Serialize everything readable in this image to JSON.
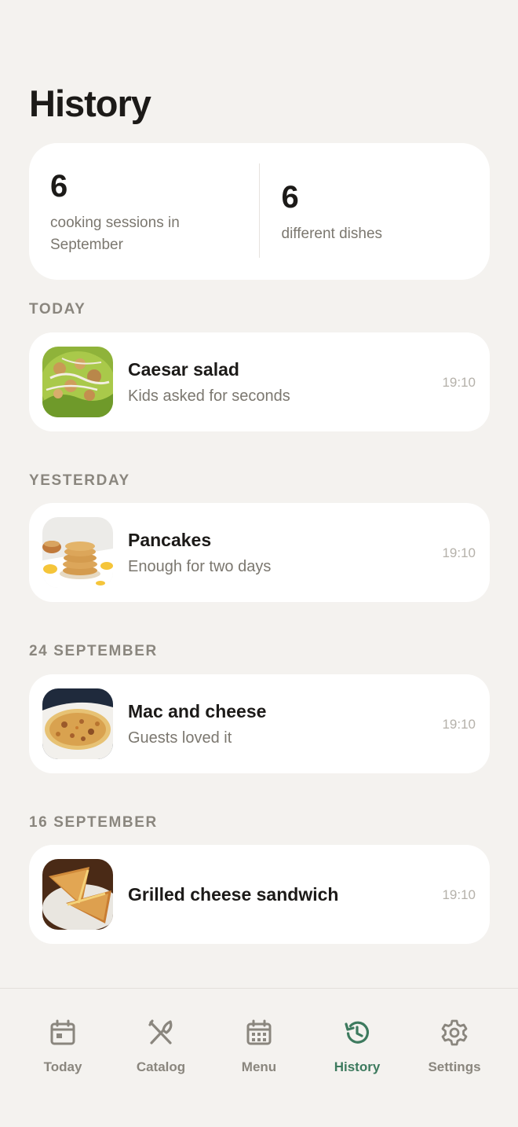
{
  "page": {
    "title": "History"
  },
  "stats": {
    "sessions": {
      "value": "6",
      "label": "cooking sessions in September"
    },
    "dishes": {
      "value": "6",
      "label": "different dishes"
    }
  },
  "sections": [
    {
      "header": "TODAY",
      "entry": {
        "title": "Caesar salad",
        "note": "Kids asked for seconds",
        "time": "19:10",
        "thumb": "caesar-salad-photo"
      }
    },
    {
      "header": "YESTERDAY",
      "entry": {
        "title": "Pancakes",
        "note": "Enough for two days",
        "time": "19:10",
        "thumb": "pancakes-photo"
      }
    },
    {
      "header": "24 SEPTEMBER",
      "entry": {
        "title": "Mac and cheese",
        "note": "Guests loved it",
        "time": "19:10",
        "thumb": "mac-and-cheese-photo"
      }
    },
    {
      "header": "16 SEPTEMBER",
      "entry": {
        "title": "Grilled cheese sandwich",
        "note": "",
        "time": "19:10",
        "thumb": "grilled-cheese-photo"
      }
    }
  ],
  "nav": {
    "items": [
      {
        "label": "Today",
        "icon": "calendar-day-icon"
      },
      {
        "label": "Catalog",
        "icon": "utensils-icon"
      },
      {
        "label": "Menu",
        "icon": "calendar-grid-icon"
      },
      {
        "label": "History",
        "icon": "history-icon",
        "active": true
      },
      {
        "label": "Settings",
        "icon": "gear-icon"
      }
    ]
  },
  "colors": {
    "background": "#f4f2ef",
    "card": "#ffffff",
    "accent": "#3d7a5e",
    "muted": "#8a867e"
  }
}
